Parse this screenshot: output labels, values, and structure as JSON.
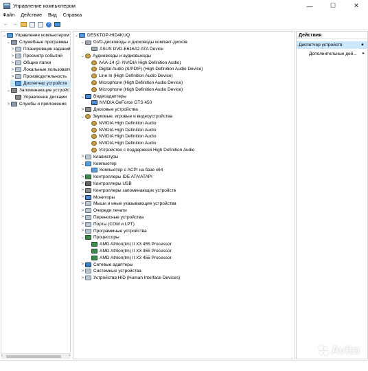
{
  "window": {
    "title": "Управление компьютером",
    "controls": [
      "minimize",
      "maximize",
      "close"
    ]
  },
  "menu": [
    "Файл",
    "Действие",
    "Вид",
    "Справка"
  ],
  "toolbar_icons": [
    "back-icon",
    "forward-icon",
    "up-folder-icon",
    "show-hide-tree-icon",
    "properties-icon",
    "help-icon",
    "monitor-icon"
  ],
  "left_tree": [
    {
      "label": "Управление компьютером (л",
      "level": 0,
      "arrow": "⌄",
      "icon": "comp"
    },
    {
      "label": "Служебные программы",
      "level": 1,
      "arrow": "⌄",
      "icon": "tool"
    },
    {
      "label": "Планировщик заданий",
      "level": 2,
      "arrow": ">",
      "icon": "gen"
    },
    {
      "label": "Просмотр событий",
      "level": 2,
      "arrow": ">",
      "icon": "gen"
    },
    {
      "label": "Общие папки",
      "level": 2,
      "arrow": ">",
      "icon": "gen"
    },
    {
      "label": "Локальные пользовате",
      "level": 2,
      "arrow": ">",
      "icon": "gen"
    },
    {
      "label": "Производительность",
      "level": 2,
      "arrow": ">",
      "icon": "gen"
    },
    {
      "label": "Диспетчер устройств",
      "level": 2,
      "arrow": "",
      "icon": "comp",
      "selected": true
    },
    {
      "label": "Запоминающие устройст",
      "level": 1,
      "arrow": "⌄",
      "icon": "disk"
    },
    {
      "label": "Управление дисками",
      "level": 2,
      "arrow": "",
      "icon": "disk"
    },
    {
      "label": "Службы и приложения",
      "level": 1,
      "arrow": ">",
      "icon": "tool"
    }
  ],
  "device_tree": [
    {
      "label": "DESKTOP-HID4KUQ",
      "level": 0,
      "arrow": "⌄",
      "icon": "comp"
    },
    {
      "label": "DVD-дисководы и дисководы компакт-дисков",
      "level": 1,
      "arrow": "⌄",
      "icon": "drive"
    },
    {
      "label": "ASUS DVD-E616A2 ATA Device",
      "level": 2,
      "arrow": "",
      "icon": "drive"
    },
    {
      "label": "Аудиовходы и аудиовыходы",
      "level": 1,
      "arrow": "⌄",
      "icon": "aud"
    },
    {
      "label": "AAA-14 (2- NVIDIA High Definition Audio)",
      "level": 2,
      "arrow": "",
      "icon": "aud"
    },
    {
      "label": "Digital Audio (S/PDIF) (High Definition Audio Device)",
      "level": 2,
      "arrow": "",
      "icon": "aud"
    },
    {
      "label": "Line In (High Definition Audio Device)",
      "level": 2,
      "arrow": "",
      "icon": "aud"
    },
    {
      "label": "Microphone (High Definition Audio Device)",
      "level": 2,
      "arrow": "",
      "icon": "aud"
    },
    {
      "label": "Microphone (High Definition Audio Device)",
      "level": 2,
      "arrow": "",
      "icon": "aud"
    },
    {
      "label": "Видеоадаптеры",
      "level": 1,
      "arrow": "⌄",
      "icon": "mon"
    },
    {
      "label": "NVIDIA GeForce GTS 450",
      "level": 2,
      "arrow": "",
      "icon": "mon"
    },
    {
      "label": "Дисковые устройства",
      "level": 1,
      "arrow": ">",
      "icon": "disk"
    },
    {
      "label": "Звуковые, игровые и видеоустройства",
      "level": 1,
      "arrow": "⌄",
      "icon": "aud"
    },
    {
      "label": "NVIDIA High Definition Audio",
      "level": 2,
      "arrow": "",
      "icon": "aud"
    },
    {
      "label": "NVIDIA High Definition Audio",
      "level": 2,
      "arrow": "",
      "icon": "aud"
    },
    {
      "label": "NVIDIA High Definition Audio",
      "level": 2,
      "arrow": "",
      "icon": "aud"
    },
    {
      "label": "NVIDIA High Definition Audio",
      "level": 2,
      "arrow": "",
      "icon": "aud"
    },
    {
      "label": "Устройство с поддержкой High Definition Audio",
      "level": 2,
      "arrow": "",
      "icon": "aud"
    },
    {
      "label": "Клавиатуры",
      "level": 1,
      "arrow": ">",
      "icon": "gen"
    },
    {
      "label": "Компьютер",
      "level": 1,
      "arrow": "⌄",
      "icon": "comp"
    },
    {
      "label": "Компьютер с ACPI на базе x64",
      "level": 2,
      "arrow": "",
      "icon": "comp"
    },
    {
      "label": "Контроллеры IDE ATA/ATAPI",
      "level": 1,
      "arrow": ">",
      "icon": "chip"
    },
    {
      "label": "Контроллеры USB",
      "level": 1,
      "arrow": ">",
      "icon": "usb"
    },
    {
      "label": "Контроллеры запоминающих устройств",
      "level": 1,
      "arrow": ">",
      "icon": "disk"
    },
    {
      "label": "Мониторы",
      "level": 1,
      "arrow": ">",
      "icon": "mon"
    },
    {
      "label": "Мыши и иные указывающие устройства",
      "level": 1,
      "arrow": ">",
      "icon": "gen"
    },
    {
      "label": "Очереди печати",
      "level": 1,
      "arrow": ">",
      "icon": "gen"
    },
    {
      "label": "Переносные устройства",
      "level": 1,
      "arrow": ">",
      "icon": "gen"
    },
    {
      "label": "Порты (COM и LPT)",
      "level": 1,
      "arrow": ">",
      "icon": "gen"
    },
    {
      "label": "Программные устройства",
      "level": 1,
      "arrow": ">",
      "icon": "gen"
    },
    {
      "label": "Процессоры",
      "level": 1,
      "arrow": "⌄",
      "icon": "chip"
    },
    {
      "label": "AMD Athlon(tm) II X3 455 Processor",
      "level": 2,
      "arrow": "",
      "icon": "chip"
    },
    {
      "label": "AMD Athlon(tm) II X3 455 Processor",
      "level": 2,
      "arrow": "",
      "icon": "chip"
    },
    {
      "label": "AMD Athlon(tm) II X3 455 Processor",
      "level": 2,
      "arrow": "",
      "icon": "chip"
    },
    {
      "label": "Сетевые адаптеры",
      "level": 1,
      "arrow": ">",
      "icon": "net"
    },
    {
      "label": "Системные устройства",
      "level": 1,
      "arrow": ">",
      "icon": "gen"
    },
    {
      "label": "Устройства HID (Human Interface Devices)",
      "level": 1,
      "arrow": ">",
      "icon": "gen"
    }
  ],
  "actions": {
    "title": "Действия",
    "section": "Диспетчер устройств",
    "more": "Дополнительные дей..."
  },
  "watermark": "Avito"
}
